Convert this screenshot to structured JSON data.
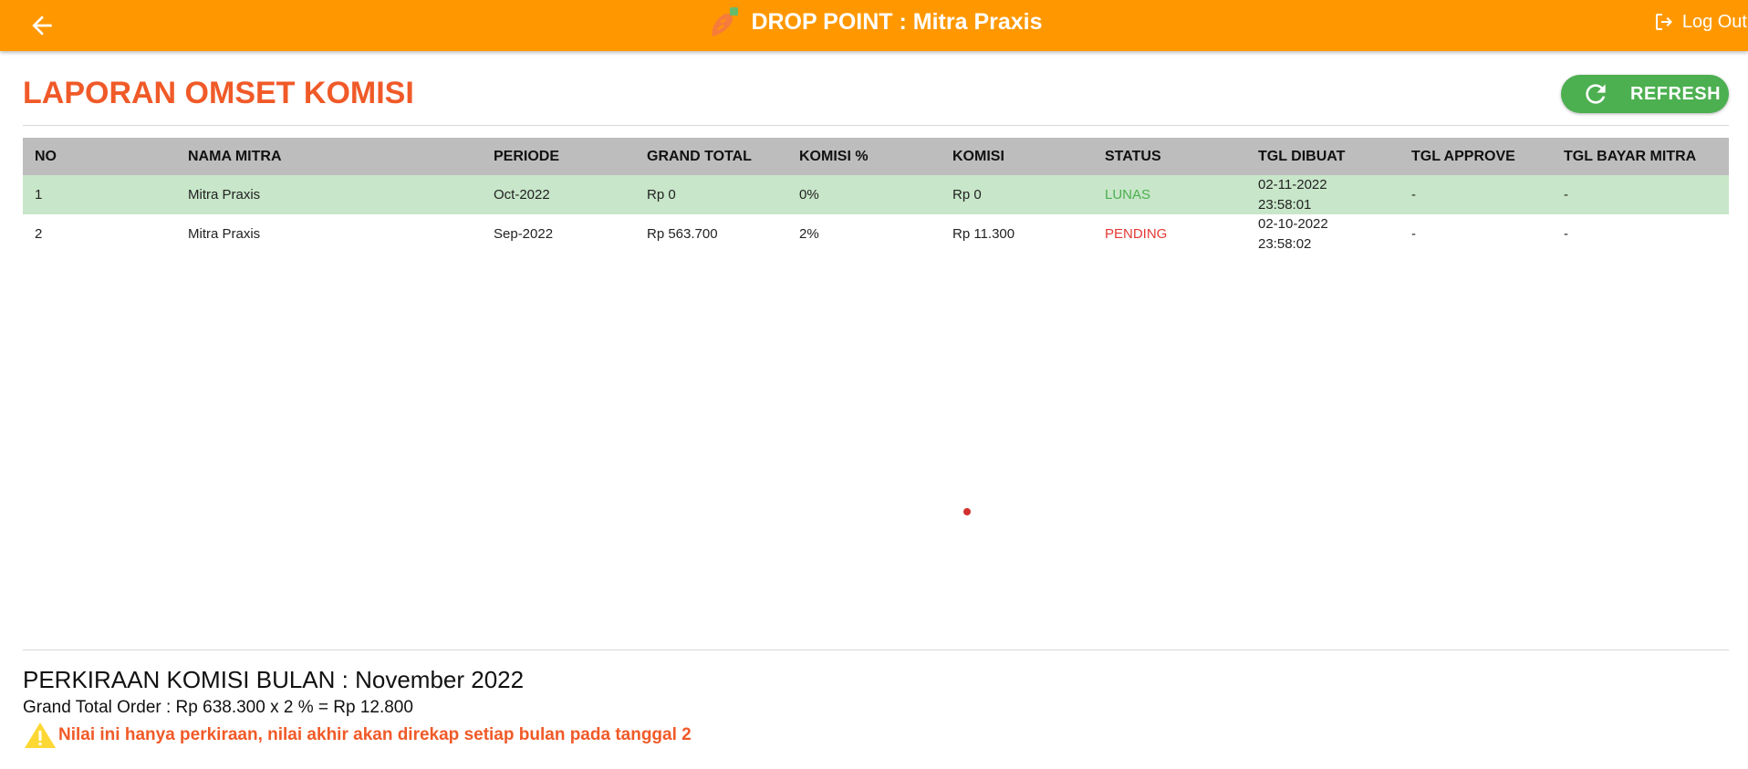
{
  "header": {
    "title": "DROP POINT : Mitra Praxis",
    "logout_label": "Log Out",
    "logo_icon": "carrot-logo-icon",
    "back_icon": "arrow-left-icon",
    "logout_icon": "logout-icon"
  },
  "page": {
    "title": "LAPORAN OMSET KOMISI",
    "refresh_label": "REFRESH",
    "refresh_icon": "refresh-icon"
  },
  "table": {
    "columns": [
      "NO",
      "NAMA MITRA",
      "PERIODE",
      "GRAND TOTAL",
      "KOMISI %",
      "KOMISI",
      "STATUS",
      "TGL DIBUAT",
      "TGL APPROVE",
      "TGL BAYAR MITRA"
    ],
    "rows": [
      {
        "no": "1",
        "nama_mitra": "Mitra Praxis",
        "periode": "Oct-2022",
        "grand_total": "Rp 0",
        "komisi_persen": "0%",
        "komisi": "Rp 0",
        "status": "LUNAS",
        "tgl_dibuat_date": "02-11-2022",
        "tgl_dibuat_time": "23:58:01",
        "tgl_approve": "-",
        "tgl_bayar": "-"
      },
      {
        "no": "2",
        "nama_mitra": "Mitra Praxis",
        "periode": "Sep-2022",
        "grand_total": "Rp 563.700",
        "komisi_persen": "2%",
        "komisi": "Rp 11.300",
        "status": "PENDING",
        "tgl_dibuat_date": "02-10-2022",
        "tgl_dibuat_time": "23:58:02",
        "tgl_approve": "-",
        "tgl_bayar": "-"
      }
    ]
  },
  "estimate": {
    "title": "PERKIRAAN KOMISI BULAN : November 2022",
    "formula": "Grand Total Order : Rp 638.300 x 2 % = Rp 12.800",
    "warning": "Nilai ini hanya perkiraan, nilai akhir akan direkap setiap bulan pada tanggal 2",
    "warning_icon": "warning-icon"
  },
  "colors": {
    "header_bg": "#ff9800",
    "title_accent": "#f05a28",
    "refresh_bg": "#4caf50",
    "row_lunas_bg": "#c8e6c9",
    "status_lunas": "#4caf50",
    "status_pending": "#e53935",
    "table_header_bg": "#bdbdbd"
  }
}
